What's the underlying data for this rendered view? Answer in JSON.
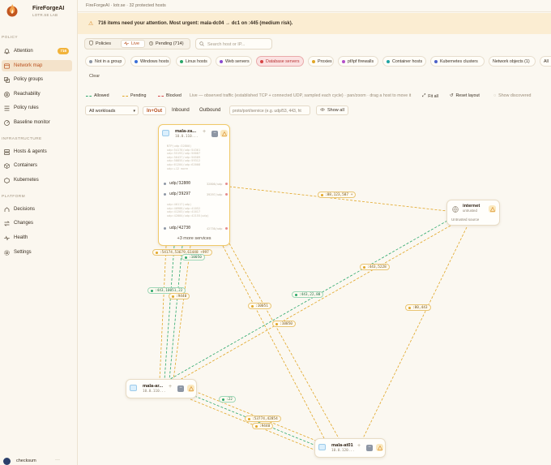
{
  "brand": {
    "name": "FireForgeAI",
    "subtitle": "LOTR.SE LAB"
  },
  "topbar": {
    "text": "FireForgeAI · lotr.se · 32 protected hosts"
  },
  "alert": {
    "text": "716 items need your attention. Most urgent: mala-dc04 → dc1 on :445 (medium risk)."
  },
  "sidebar": {
    "sections": [
      {
        "label": "POLICY",
        "items": [
          {
            "label": "Attention",
            "icon": "bell-icon",
            "badge": "716"
          },
          {
            "label": "Network map",
            "icon": "network-map-icon",
            "active": true
          },
          {
            "label": "Policy groups",
            "icon": "layers-icon"
          },
          {
            "label": "Reachability",
            "icon": "target-icon"
          },
          {
            "label": "Policy rules",
            "icon": "list-icon"
          },
          {
            "label": "Baseline monitor",
            "icon": "radar-icon"
          }
        ]
      },
      {
        "label": "INFRASTRUCTURE",
        "items": [
          {
            "label": "Hosts & agents",
            "icon": "server-icon"
          },
          {
            "label": "Containers",
            "icon": "box-icon"
          },
          {
            "label": "Kubernetes",
            "icon": "kubernetes-icon"
          }
        ]
      },
      {
        "label": "PLATFORM",
        "items": [
          {
            "label": "Decisions",
            "icon": "decision-icon"
          },
          {
            "label": "Changes",
            "icon": "swap-icon"
          },
          {
            "label": "Health",
            "icon": "pulse-icon"
          },
          {
            "label": "Settings",
            "icon": "gear-icon"
          }
        ]
      }
    ],
    "user": {
      "name": "checksum",
      "more": "···"
    }
  },
  "view_tabs": [
    {
      "label": "Policies",
      "icon": "shield-icon"
    },
    {
      "label": "Live",
      "icon": "activity-icon",
      "active": true
    },
    {
      "label": "Pending (714)",
      "icon": "clock-icon"
    }
  ],
  "search": {
    "placeholder": "Search host or IP..."
  },
  "chips": [
    {
      "label": "Not in a group",
      "color": "#8d96a4"
    },
    {
      "label": "Windows hosts",
      "color": "#3a6fd8"
    },
    {
      "label": "Linux hosts",
      "color": "#2aa76a"
    },
    {
      "label": "Web servers",
      "color": "#8a4bd1"
    },
    {
      "label": "Database servers",
      "color": "#d64545",
      "selected": true
    },
    {
      "label": "Proxies",
      "color": "#e1a626"
    },
    {
      "label": "pf/ipf firewalls",
      "color": "#b34fc9"
    },
    {
      "label": "Container hosts",
      "color": "#1fa3a3"
    },
    {
      "label": "Kubernetes clusters",
      "color": "#4d62c9"
    },
    {
      "label": "Network objects (1)",
      "color": null
    },
    {
      "label": "All",
      "color": null
    }
  ],
  "clear_label": "Clear",
  "legend": {
    "allowed": "Allowed",
    "pending": "Pending",
    "blocked": "Blocked",
    "live_note": "Live — observed traffic (established TCP + connected UDP, sampled each cycle) · pan/zoom · drag a host to move it",
    "fit_all": "Fit all",
    "reset_layout": "Reset layout",
    "show_discovered": "Show discovered"
  },
  "workload_select": {
    "value": "All workloads"
  },
  "direction": [
    {
      "label": "In+Out",
      "active": true
    },
    {
      "label": "Inbound"
    },
    {
      "label": "Outbound"
    }
  ],
  "port_filter": {
    "placeholder": "proto/port/service (e.g. udp/53, 443, ht"
  },
  "show_all_label": "Show all",
  "colors": {
    "accent": "#c2561f",
    "pending": "#e1a626",
    "allowed": "#2aa76a",
    "blocked": "#d64545"
  },
  "nodes": {
    "top": {
      "name": "mala-za...",
      "ip": "10.0.110...",
      "faded1": "NTP(udp:32800)\nudp:54176/udp:54361\nudp:55193/udp:56087\nudp:56437/udp:56589\nudp:58855/udp:59312\nudp:61204/udp:62008\nudp:+12 more",
      "ports": [
        {
          "label": "udp/32800",
          "tag": "32800/udp"
        },
        {
          "label": "udp/39297",
          "tag": "39297/udp"
        },
        {
          "label": "udp/42730",
          "tag": "42730/udp"
        }
      ],
      "faded2": "udp:40117(udp)\nudp:40988/udp:41052\nudp:41203/udp:41617\nudp:42004/udp:42155(udp)",
      "more": "+3 more services"
    },
    "internet": {
      "name": "internet",
      "sub": "untrusted",
      "source": "Untrusted source"
    },
    "mid": {
      "name": "mala-ar...",
      "ip": "10.0.110..."
    },
    "bottom": {
      "name": "mala-at01",
      "ip": "10.0.120..."
    }
  },
  "edge_labels": {
    "l1": ":88,123,587 +",
    "l2": ":54174,53679,61448 +997",
    "l3": ":10050",
    "l4": ":443,10051,22",
    "l5": ":9440",
    "l6": ":443,22,88",
    "l7": ":443,5228",
    "l8": ":10051",
    "l9": ":10050",
    "l10": ":80,443",
    "l11": ":22",
    "l12": ":53774,42854",
    "l13": ":9440"
  }
}
